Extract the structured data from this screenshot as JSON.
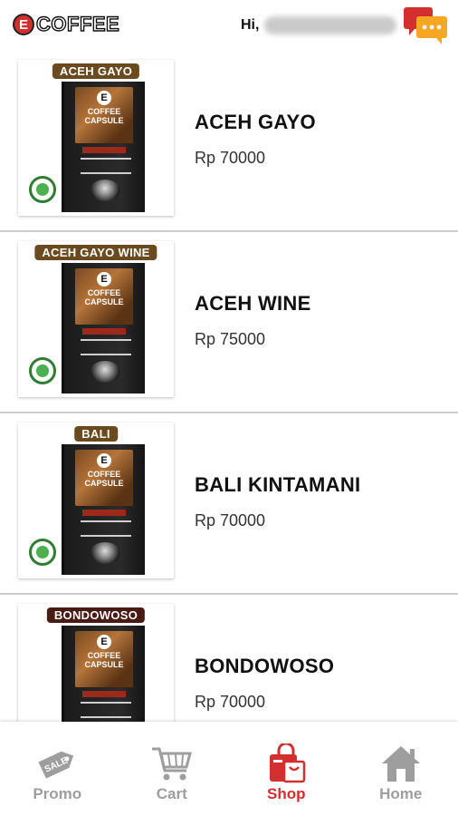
{
  "header": {
    "logo_letter": "E",
    "logo_text": "COFFEE",
    "greeting": "Hi,"
  },
  "products": [
    {
      "tag": "ACEH GAYO",
      "tag_color": "#6b4a1f",
      "name": "ACEH GAYO",
      "price": "Rp 70000"
    },
    {
      "tag": "ACEH GAYO WINE",
      "tag_color": "#6b4a1f",
      "name": "ACEH WINE",
      "price": "Rp 75000"
    },
    {
      "tag": "BALI",
      "tag_color": "#6b4a1f",
      "name": "BALI KINTAMANI",
      "price": "Rp 70000"
    },
    {
      "tag": "BONDOWOSO",
      "tag_color": "#4a1a14",
      "name": "BONDOWOSO",
      "price": "Rp 70000"
    }
  ],
  "package": {
    "letter": "E",
    "caption": "COFFEE CAPSULE"
  },
  "nav": [
    {
      "label": "Promo",
      "icon": "sale-tag-icon",
      "active": false
    },
    {
      "label": "Cart",
      "icon": "cart-icon",
      "active": false
    },
    {
      "label": "Shop",
      "icon": "shopping-bag-icon",
      "active": true
    },
    {
      "label": "Home",
      "icon": "home-icon",
      "active": false
    }
  ],
  "colors": {
    "accent": "#d32f2f",
    "chat_back": "#d32f2f",
    "chat_front": "#f5a623",
    "inactive": "#9e9e9e"
  }
}
